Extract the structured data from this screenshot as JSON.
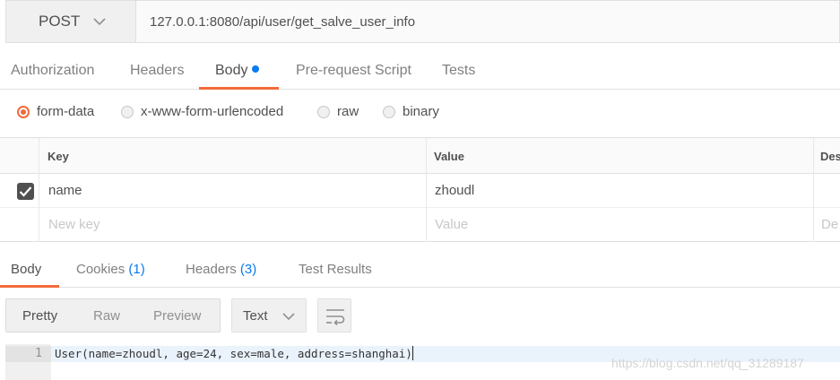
{
  "request": {
    "method": "POST",
    "url": "127.0.0.1:8080/api/user/get_salve_user_info"
  },
  "request_tabs": [
    {
      "label": "Authorization",
      "active": false
    },
    {
      "label": "Headers",
      "active": false
    },
    {
      "label": "Body",
      "active": true
    },
    {
      "label": "Pre-request Script",
      "active": false
    },
    {
      "label": "Tests",
      "active": false
    }
  ],
  "body_types": [
    {
      "label": "form-data",
      "selected": true
    },
    {
      "label": "x-www-form-urlencoded",
      "selected": false
    },
    {
      "label": "raw",
      "selected": false
    },
    {
      "label": "binary",
      "selected": false
    }
  ],
  "params_table": {
    "headers": [
      "Key",
      "Value",
      "Des"
    ],
    "rows": [
      {
        "checked": true,
        "key": "name",
        "value": "zhoudl"
      }
    ],
    "placeholders": {
      "key": "New key",
      "value": "Value",
      "description": "De"
    }
  },
  "response_tabs": [
    {
      "label": "Body",
      "count": "",
      "active": true
    },
    {
      "label": "Cookies",
      "count": "(1)",
      "active": false
    },
    {
      "label": "Headers",
      "count": "(3)",
      "active": false
    },
    {
      "label": "Test Results",
      "count": "",
      "active": false
    }
  ],
  "view_modes": [
    {
      "label": "Pretty",
      "active": true
    },
    {
      "label": "Raw",
      "active": false
    },
    {
      "label": "Preview",
      "active": false
    }
  ],
  "format_select": {
    "value": "Text"
  },
  "response_body": {
    "line_number": "1",
    "text": "User(name=zhoudl, age=24, sex=male, address=shanghai)"
  },
  "watermark": "https://blog.csdn.net/qq_31289187",
  "colors": {
    "accent": "#f26b3a",
    "link": "#097bed"
  },
  "icons": {
    "method_dropdown": "chevron-down-icon",
    "format_dropdown": "chevron-down-icon",
    "wrap": "wrap-lines-icon",
    "checkbox": "check-icon",
    "body_dot": "dot-icon"
  }
}
